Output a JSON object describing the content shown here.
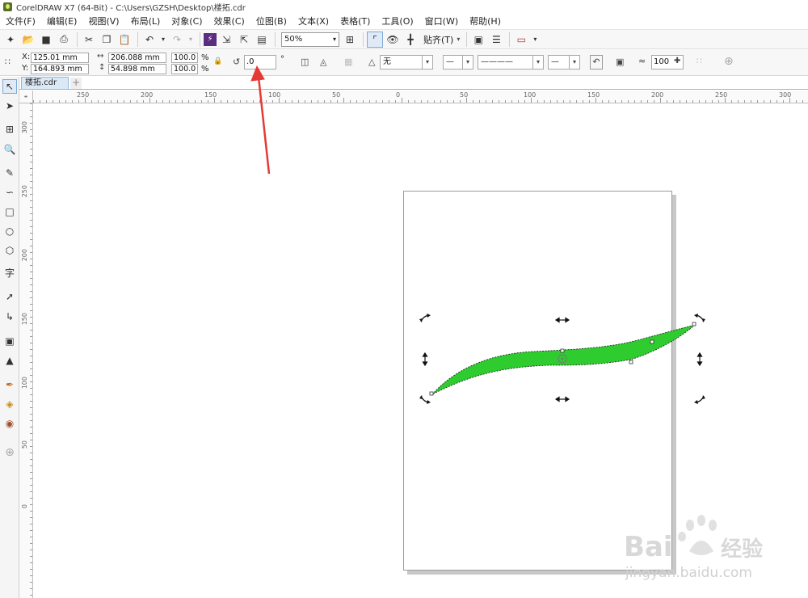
{
  "window": {
    "title": "CorelDRAW X7 (64-Bit) - C:\\Users\\GZSH\\Desktop\\楼拓.cdr"
  },
  "menu": [
    {
      "label": "文件(F)"
    },
    {
      "label": "编辑(E)"
    },
    {
      "label": "视图(V)"
    },
    {
      "label": "布局(L)"
    },
    {
      "label": "对象(C)"
    },
    {
      "label": "效果(C)"
    },
    {
      "label": "位图(B)"
    },
    {
      "label": "文本(X)"
    },
    {
      "label": "表格(T)"
    },
    {
      "label": "工具(O)"
    },
    {
      "label": "窗口(W)"
    },
    {
      "label": "帮助(H)"
    }
  ],
  "toolbar": {
    "zoom": "50%",
    "snap_label": "贴齐(T)"
  },
  "property_bar": {
    "x_label": "X:",
    "x_value": "125.01 mm",
    "y_label": "Y:",
    "y_value": "164.893 mm",
    "width_value": "206.088 mm",
    "height_value": "54.898 mm",
    "scale_w": "100.0",
    "scale_h": "100.0",
    "percent": "%",
    "rotation_value": ".0",
    "degree": "°",
    "outline_label": "无",
    "curve_smoothing": "100"
  },
  "document": {
    "tab_label": "楼拓.cdr",
    "add_tab": "+"
  },
  "ruler": {
    "h_labels": [
      "250",
      "200",
      "150",
      "100",
      "50",
      "0",
      "50",
      "100",
      "150",
      "200",
      "250",
      "300"
    ],
    "v_labels": [
      "300",
      "250",
      "200",
      "150",
      "100",
      "50",
      "0"
    ]
  },
  "watermark": {
    "brand": "Bai",
    "suffix": "经验",
    "url": "jingyan.baidu.com"
  },
  "colors": {
    "shape_fill": "#2ecc2e",
    "annotation_arrow": "#e53935"
  }
}
